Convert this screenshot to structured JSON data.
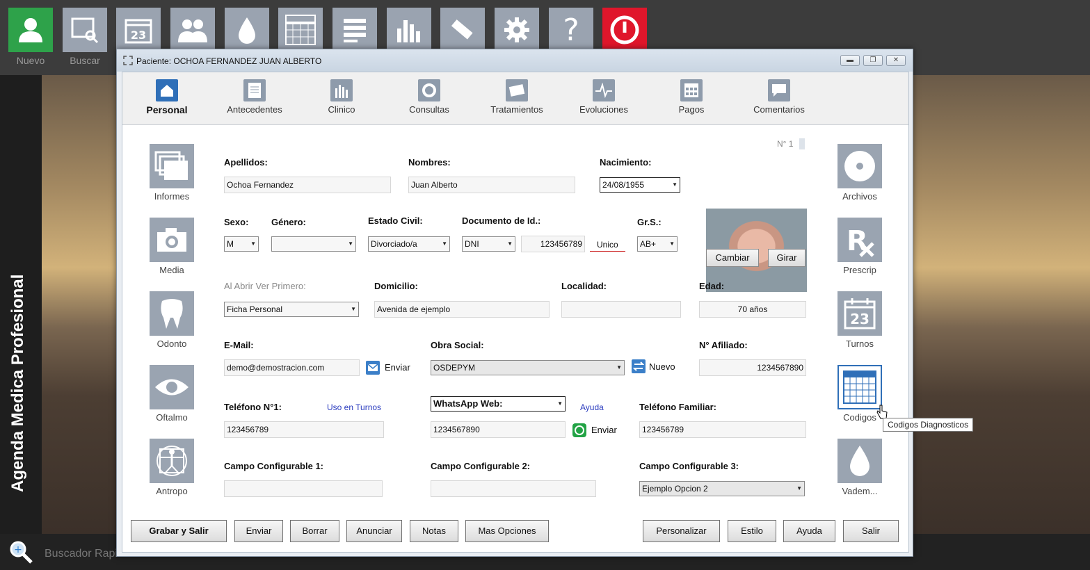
{
  "app": {
    "vertical_title": "Agenda Medica Profesional",
    "quick_search_label": "Buscador Rapido"
  },
  "toolbar": {
    "items": [
      {
        "label": "Nuevo",
        "icon": "user-icon"
      },
      {
        "label": "Buscar",
        "icon": "search-window-icon"
      },
      {
        "label": "",
        "icon": "calendar-icon",
        "day": "23"
      },
      {
        "label": "",
        "icon": "group-icon"
      },
      {
        "label": "",
        "icon": "drop-icon"
      },
      {
        "label": "",
        "icon": "grid-icon"
      },
      {
        "label": "",
        "icon": "list-icon"
      },
      {
        "label": "",
        "icon": "bar-chart-icon"
      },
      {
        "label": "",
        "icon": "usb-icon"
      },
      {
        "label": "",
        "icon": "gear-icon"
      },
      {
        "label": "",
        "icon": "help-icon",
        "glyph": "?"
      },
      {
        "label": "",
        "icon": "power-icon"
      }
    ]
  },
  "window": {
    "title": "Paciente: OCHOA FERNANDEZ JUAN ALBERTO",
    "buttons": {
      "minimize": "▬",
      "restore": "❐",
      "close": "✕"
    }
  },
  "tabs": [
    {
      "label": "Personal",
      "active": true
    },
    {
      "label": "Antecedentes"
    },
    {
      "label": "Clinico"
    },
    {
      "label": "Consultas"
    },
    {
      "label": "Tratamientos"
    },
    {
      "label": "Evoluciones"
    },
    {
      "label": "Pagos"
    },
    {
      "label": "Comentarios"
    }
  ],
  "left_side": [
    "Informes",
    "Media",
    "Odonto",
    "Oftalmo",
    "Antropo"
  ],
  "right_side": [
    "Archivos",
    "Prescrip",
    "Turnos",
    "Codigos",
    "Vadem..."
  ],
  "calendar_day": "23",
  "record_number": "N° 1",
  "form": {
    "apellidos": {
      "label": "Apellidos:",
      "value": "Ochoa Fernandez"
    },
    "nombres": {
      "label": "Nombres:",
      "value": "Juan Alberto"
    },
    "nacimiento": {
      "label": "Nacimiento:",
      "value": "24/08/1955"
    },
    "sexo": {
      "label": "Sexo:",
      "value": "M"
    },
    "genero": {
      "label": "Género:",
      "value": ""
    },
    "estado_civil": {
      "label": "Estado Civil:",
      "value": "Divorciado/a"
    },
    "documento": {
      "label": "Documento de Id.:",
      "type": "DNI",
      "value": "123456789",
      "unico": "Unico"
    },
    "grupo_sanguineo": {
      "label": "Gr.S.:",
      "value": "AB+"
    },
    "al_abrir": {
      "label": "Al Abrir Ver Primero:",
      "value": "Ficha Personal"
    },
    "domicilio": {
      "label": "Domicilio:",
      "value": "Avenida de ejemplo"
    },
    "localidad": {
      "label": "Localidad:",
      "value": ""
    },
    "edad": {
      "label": "Edad:",
      "value": "70 años"
    },
    "email": {
      "label": "E-Mail:",
      "value": "demo@demostracion.com",
      "send": "Enviar"
    },
    "obra_social": {
      "label": "Obra Social:",
      "value": "OSDEPYM",
      "nuevo": "Nuevo"
    },
    "afiliado": {
      "label": "N° Afiliado:",
      "value": "1234567890"
    },
    "telefono1": {
      "label": "Teléfono N°1:",
      "value": "123456789",
      "link": "Uso en Turnos"
    },
    "whatsapp": {
      "select": "WhatsApp Web:",
      "value": "1234567890",
      "help": "Ayuda",
      "send": "Enviar"
    },
    "telefono_familiar": {
      "label": "Teléfono Familiar:",
      "value": "123456789"
    },
    "campo1": {
      "label": "Campo Configurable 1:",
      "value": ""
    },
    "campo2": {
      "label": "Campo Configurable 2:",
      "value": ""
    },
    "campo3": {
      "label": "Campo Configurable 3:",
      "value": "Ejemplo Opcion 2"
    }
  },
  "photo_buttons": {
    "change": "Cambiar",
    "rotate": "Girar"
  },
  "footer": {
    "left": [
      "Grabar y Salir",
      "Enviar",
      "Borrar",
      "Anunciar",
      "Notas",
      "Mas Opciones"
    ],
    "right": [
      "Personalizar",
      "Estilo",
      "Ayuda",
      "Salir"
    ]
  },
  "tooltip": "Codigos Diagnosticos"
}
